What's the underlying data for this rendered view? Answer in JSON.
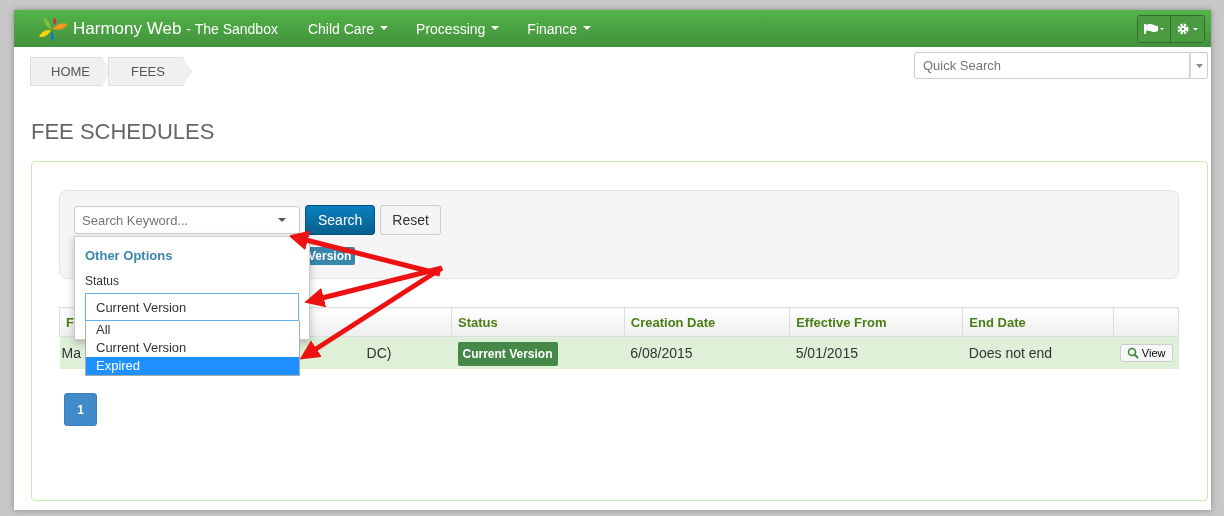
{
  "navbar": {
    "brand": "Harmony Web",
    "subtitle": "- The Sandbox",
    "menus": [
      "Child Care",
      "Processing",
      "Finance"
    ]
  },
  "breadcrumb": [
    "HOME",
    "FEES"
  ],
  "quick_search": {
    "placeholder": "Quick Search"
  },
  "page_title": "FEE SCHEDULES",
  "filter": {
    "keyword_placeholder": "Search Keyword...",
    "search_button": "Search",
    "reset_button": "Reset",
    "active_tag": "Version"
  },
  "options_dropdown": {
    "heading": "Other Options",
    "status_label": "Status",
    "status_value": "Current Version",
    "status_options": [
      {
        "label": "All",
        "selected": false
      },
      {
        "label": "Current Version",
        "selected": false
      },
      {
        "label": "Expired",
        "selected": true
      }
    ]
  },
  "table": {
    "columns": [
      "F",
      "Status",
      "Creation Date",
      "Effective From",
      "End Date"
    ],
    "rows": [
      {
        "name_start": "Ma",
        "name_end": "DC)",
        "status": "Current Version",
        "creation_date": "6/08/2015",
        "effective_from": "5/01/2015",
        "end_date": "Does not end",
        "action": "View"
      }
    ]
  },
  "pagination": [
    {
      "label": "1",
      "selected": true
    }
  ]
}
